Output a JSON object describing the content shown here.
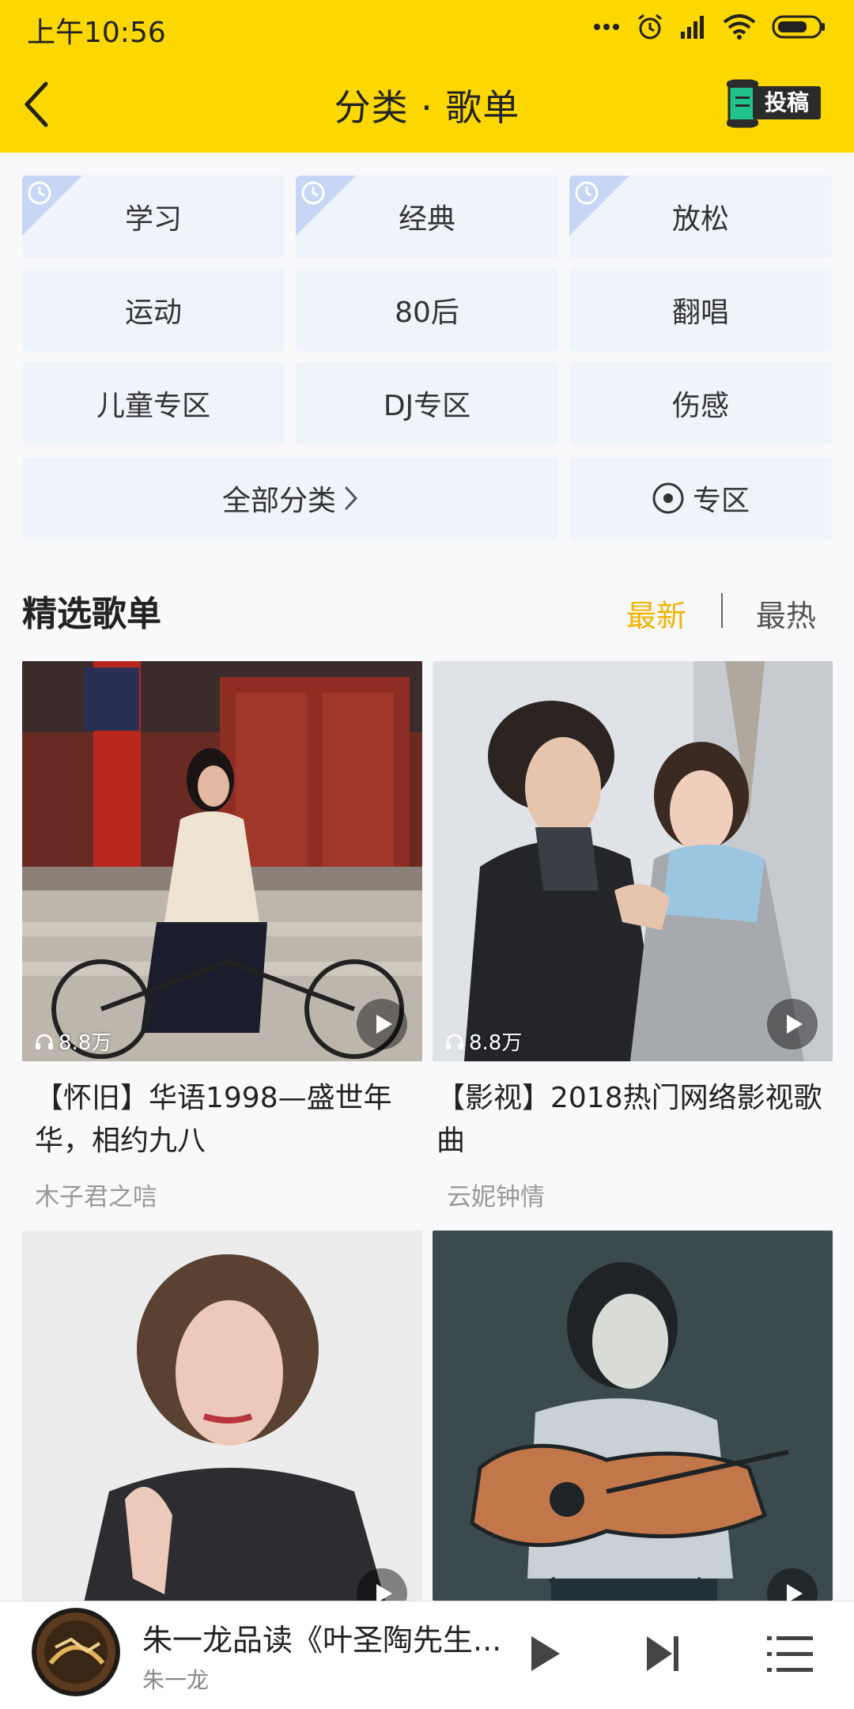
{
  "status_bar": {
    "time": "上午10:56"
  },
  "header": {
    "title": "分类 · 歌单",
    "submit_label": "投稿"
  },
  "categories": {
    "items": [
      "学习",
      "经典",
      "放松",
      "运动",
      "80后",
      "翻唱",
      "儿童专区",
      "DJ专区",
      "伤感"
    ],
    "all_label": "全部分类",
    "zone_label": "专区"
  },
  "section": {
    "title": "精选歌单",
    "tab_new": "最新",
    "tab_hot": "最热"
  },
  "playlists": [
    {
      "title": "【怀旧】华语1998—盛世年华，相约九八",
      "author": "木子君之唁",
      "plays": "8.8万"
    },
    {
      "title": "【影视】2018热门网络影视歌曲",
      "author": "云妮钟情",
      "plays": "8.8万"
    }
  ],
  "player": {
    "title": "朱一龙品读《叶圣陶先生...",
    "artist": "朱一龙"
  },
  "colors": {
    "accent_yellow": "#fdd700",
    "tab_active": "#f1b200",
    "tile_bg": "#eff3fa"
  }
}
